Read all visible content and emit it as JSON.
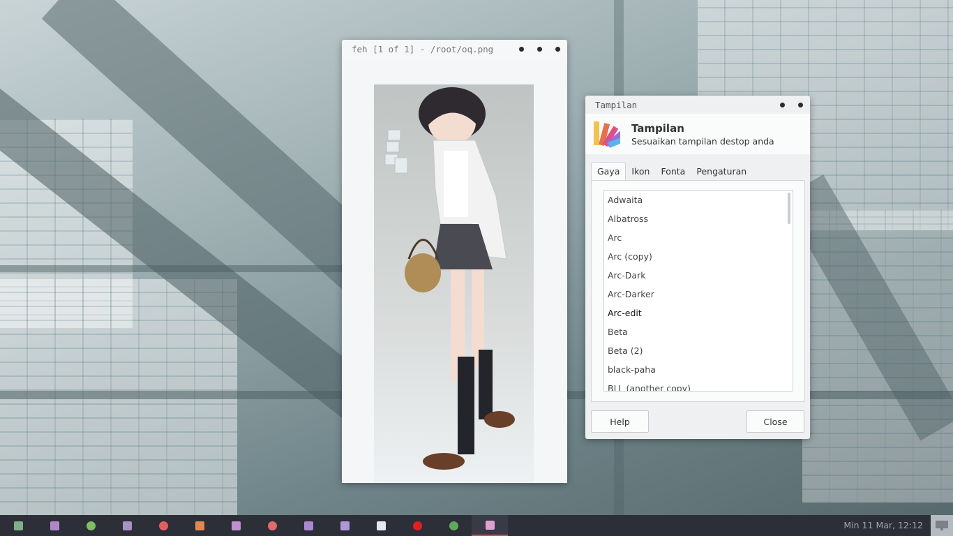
{
  "feh_window": {
    "title": "feh [1 of 1] - /root/oq.png"
  },
  "tampilan_window": {
    "title": "Tampilan",
    "header_title": "Tampilan",
    "header_subtitle": "Sesuaikan tampilan destop anda",
    "tabs": [
      {
        "label": "Gaya",
        "active": true
      },
      {
        "label": "Ikon",
        "active": false
      },
      {
        "label": "Fonta",
        "active": false
      },
      {
        "label": "Pengaturan",
        "active": false
      }
    ],
    "themes": [
      "Adwaita",
      "Albatross",
      "Arc",
      "Arc (copy)",
      "Arc-Dark",
      "Arc-Darker",
      "Arc-edit",
      "Beta",
      "Beta (2)",
      "black-paha",
      "BLL (another copy)"
    ],
    "selected_theme": "Arc-edit",
    "help_label": "Help",
    "close_label": "Close"
  },
  "taskbar": {
    "clock": "Min 11 Mar, 12:12",
    "apps": [
      {
        "icon": "file-manager-icon",
        "color": "#7fb08a"
      },
      {
        "icon": "text-editor-icon",
        "color": "#b088c8"
      },
      {
        "icon": "network-icon",
        "color": "#7cc060"
      },
      {
        "icon": "document-icon",
        "color": "#a890c0"
      },
      {
        "icon": "monitor-icon",
        "color": "#e06060"
      },
      {
        "icon": "presentation-icon",
        "color": "#e08850"
      },
      {
        "icon": "arch-icon",
        "color": "#c090d0"
      },
      {
        "icon": "close-app-icon",
        "color": "#e06a70"
      },
      {
        "icon": "feather-icon",
        "color": "#a888d0"
      },
      {
        "icon": "folder-icon",
        "color": "#b098d8"
      },
      {
        "icon": "files-icon",
        "color": "#e8e8f0"
      },
      {
        "icon": "opera-icon",
        "color": "#e02020"
      },
      {
        "icon": "image-viewer-icon",
        "color": "#60a860"
      },
      {
        "icon": "appearance-icon",
        "color": "#e0a0d0"
      }
    ],
    "active_app": "appearance-icon"
  }
}
